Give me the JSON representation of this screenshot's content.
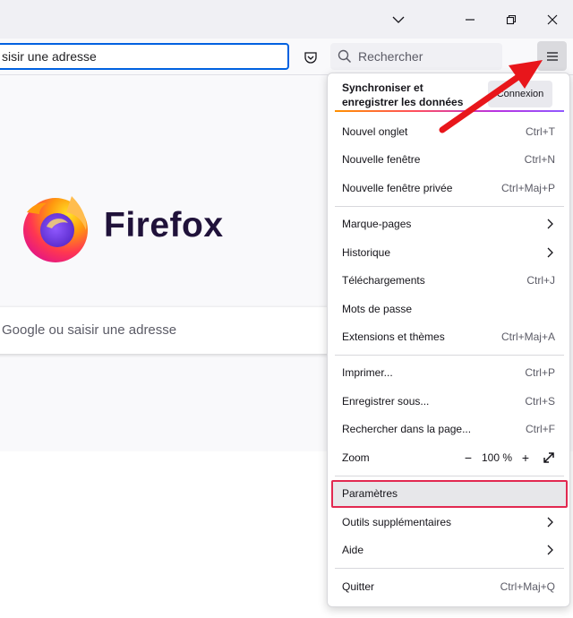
{
  "browser": {
    "url_text": "sisir une adresse",
    "search_placeholder": "Rechercher"
  },
  "brand": {
    "name": "Firefox"
  },
  "newtab": {
    "search_placeholder": "Google ou saisir une adresse"
  },
  "menu": {
    "sync_title": "Synchroniser et enregistrer les données",
    "connect_label": "Connexion",
    "items": [
      {
        "label": "Nouvel onglet",
        "shortcut": "Ctrl+T"
      },
      {
        "label": "Nouvelle fenêtre",
        "shortcut": "Ctrl+N"
      },
      {
        "label": "Nouvelle fenêtre privée",
        "shortcut": "Ctrl+Maj+P"
      },
      {
        "label": "Marque-pages",
        "shortcut": ""
      },
      {
        "label": "Historique",
        "shortcut": ""
      },
      {
        "label": "Téléchargements",
        "shortcut": "Ctrl+J"
      },
      {
        "label": "Mots de passe",
        "shortcut": ""
      },
      {
        "label": "Extensions et thèmes",
        "shortcut": "Ctrl+Maj+A"
      },
      {
        "label": "Imprimer...",
        "shortcut": "Ctrl+P"
      },
      {
        "label": "Enregistrer sous...",
        "shortcut": "Ctrl+S"
      },
      {
        "label": "Rechercher dans la page...",
        "shortcut": "Ctrl+F"
      },
      {
        "label": "Zoom",
        "shortcut": ""
      },
      {
        "label": "Paramètres",
        "shortcut": ""
      },
      {
        "label": "Outils supplémentaires",
        "shortcut": ""
      },
      {
        "label": "Aide",
        "shortcut": ""
      },
      {
        "label": "Quitter",
        "shortcut": "Ctrl+Maj+Q"
      }
    ],
    "zoom": {
      "minus": "−",
      "value": "100 %",
      "plus": "+"
    }
  },
  "colors": {
    "highlight_border": "#e22850",
    "annotation_arrow": "#e8161b",
    "url_focus": "#0061e0"
  }
}
